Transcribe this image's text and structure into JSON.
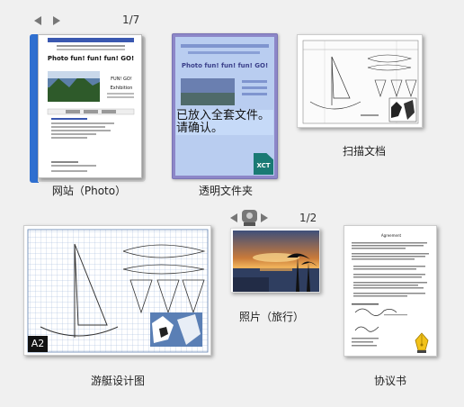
{
  "items": {
    "website": {
      "label": "网站（Photo）",
      "page_counter": "1/7",
      "headline": "Photo fun! fun! fun! GO!",
      "side_title_1": "FUN! GO!",
      "side_title_2": "Exhibition"
    },
    "folder": {
      "label": "透明文件夹",
      "note": "已放入全套文件。请确认。",
      "badge": "XCT",
      "headline": "Photo fun! fun! fun! GO!"
    },
    "scan": {
      "label": "扫描文档"
    },
    "yacht": {
      "label": "游艇设计图",
      "badge": "A2"
    },
    "photo": {
      "label": "照片（旅行）",
      "page_counter": "1/2"
    },
    "agreement": {
      "label": "协议书",
      "title": "Agreement"
    }
  },
  "colors": {
    "background": "#f0f0f0",
    "folder_fill": "#b9cdf0",
    "folder_tint": "#8d87c8",
    "binder": "#2f6fd0",
    "xct_badge": "#1a7a74"
  }
}
